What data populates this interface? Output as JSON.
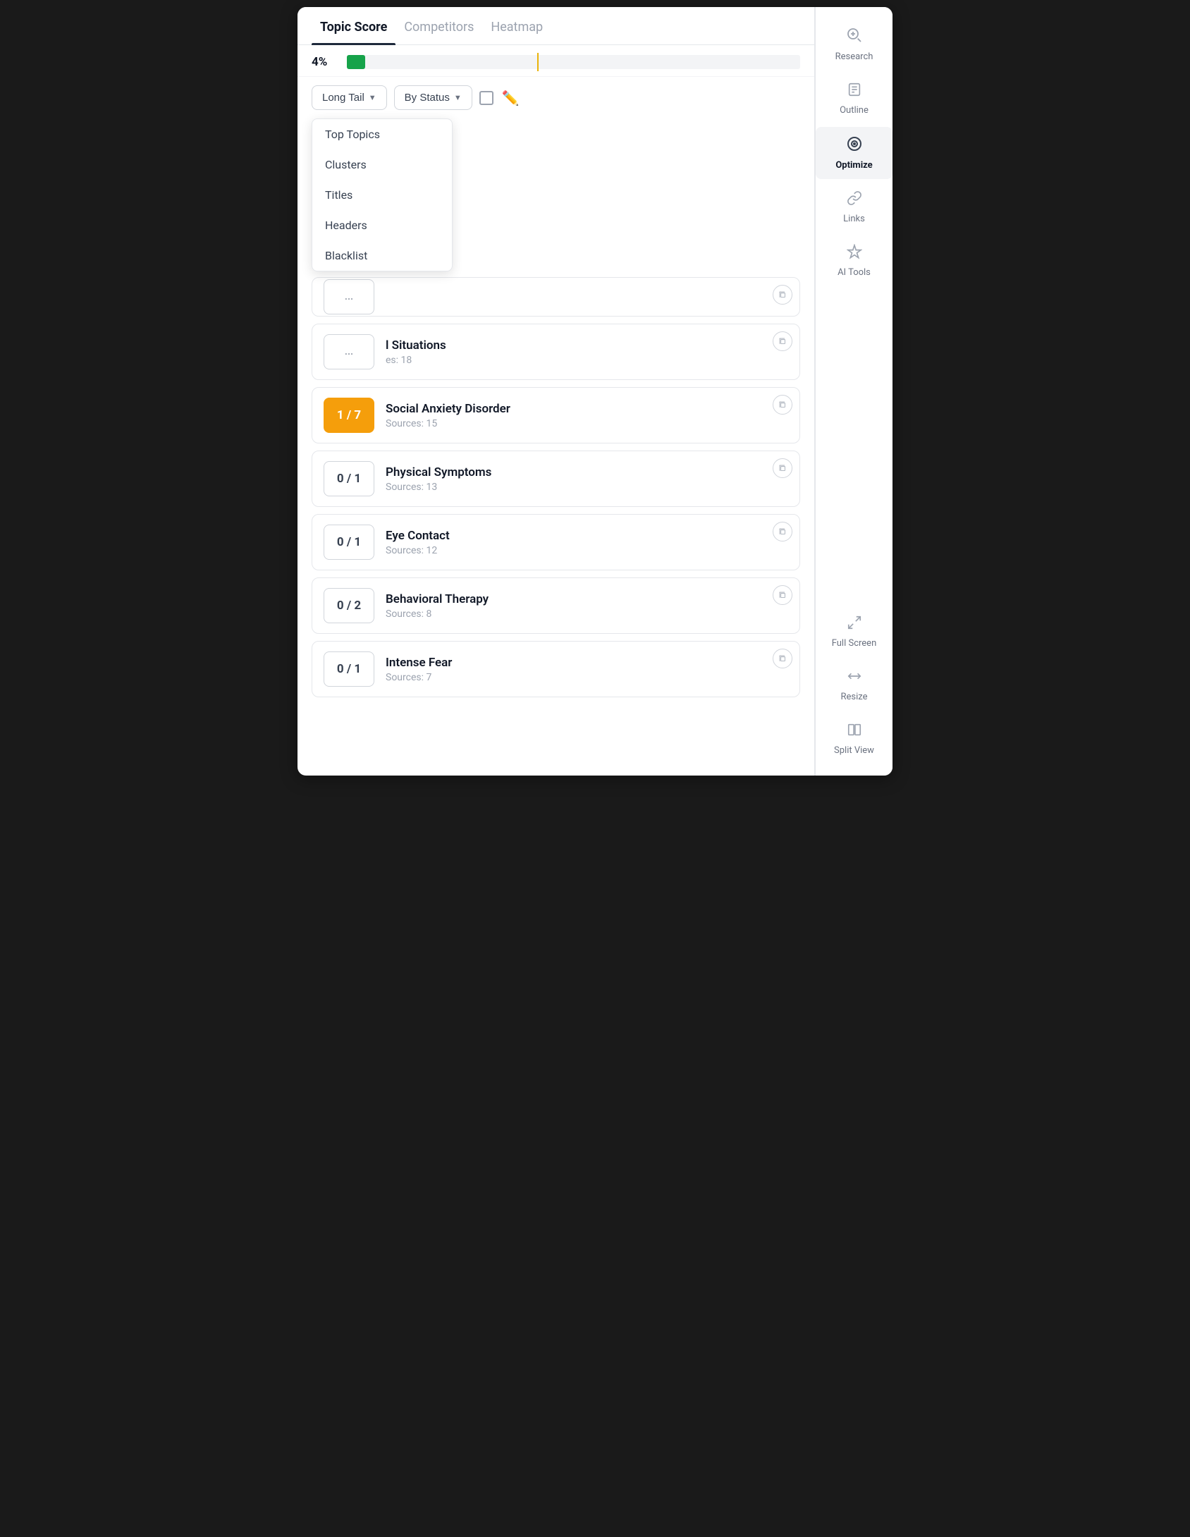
{
  "tabs": [
    {
      "label": "Topic Score",
      "active": true
    },
    {
      "label": "Competitors",
      "active": false
    },
    {
      "label": "Heatmap",
      "active": false
    }
  ],
  "progress": {
    "percent": "4%",
    "fill_width": "4%"
  },
  "controls": {
    "dropdown1_label": "Long Tail",
    "dropdown2_label": "By Status",
    "dropdown_menu": {
      "items": [
        "Top Topics",
        "Clusters",
        "Titles",
        "Headers",
        "Blacklist"
      ]
    }
  },
  "topics": [
    {
      "score": "...",
      "title": "",
      "sources": "",
      "is_ellipsis": true,
      "score_type": "neutral"
    },
    {
      "score": "...",
      "title": "l Situations",
      "sources": "es: 18",
      "is_partial": true,
      "score_type": "neutral"
    },
    {
      "score": "1 / 7",
      "title": "Social Anxiety Disorder",
      "sources": "Sources: 15",
      "score_type": "orange"
    },
    {
      "score": "0 / 1",
      "title": "Physical Symptoms",
      "sources": "Sources: 13",
      "score_type": "neutral"
    },
    {
      "score": "0 / 1",
      "title": "Eye Contact",
      "sources": "Sources: 12",
      "score_type": "neutral"
    },
    {
      "score": "0 / 2",
      "title": "Behavioral Therapy",
      "sources": "Sources: 8",
      "score_type": "neutral"
    },
    {
      "score": "0 / 1",
      "title": "Intense Fear",
      "sources": "Sources: 7",
      "score_type": "neutral"
    }
  ],
  "sidebar": {
    "items": [
      {
        "id": "research",
        "label": "Research",
        "icon": "🔭"
      },
      {
        "id": "outline",
        "label": "Outline",
        "icon": "📄"
      },
      {
        "id": "optimize",
        "label": "Optimize",
        "icon": "🎯",
        "active": true
      },
      {
        "id": "links",
        "label": "Links",
        "icon": "🔗"
      },
      {
        "id": "ai-tools",
        "label": "AI Tools",
        "icon": "✨"
      }
    ],
    "bottom_items": [
      {
        "id": "full-screen",
        "label": "Full Screen",
        "icon": "⛶"
      },
      {
        "id": "resize",
        "label": "Resize",
        "icon": "↔"
      },
      {
        "id": "split-view",
        "label": "Split View",
        "icon": "⊞"
      }
    ]
  }
}
